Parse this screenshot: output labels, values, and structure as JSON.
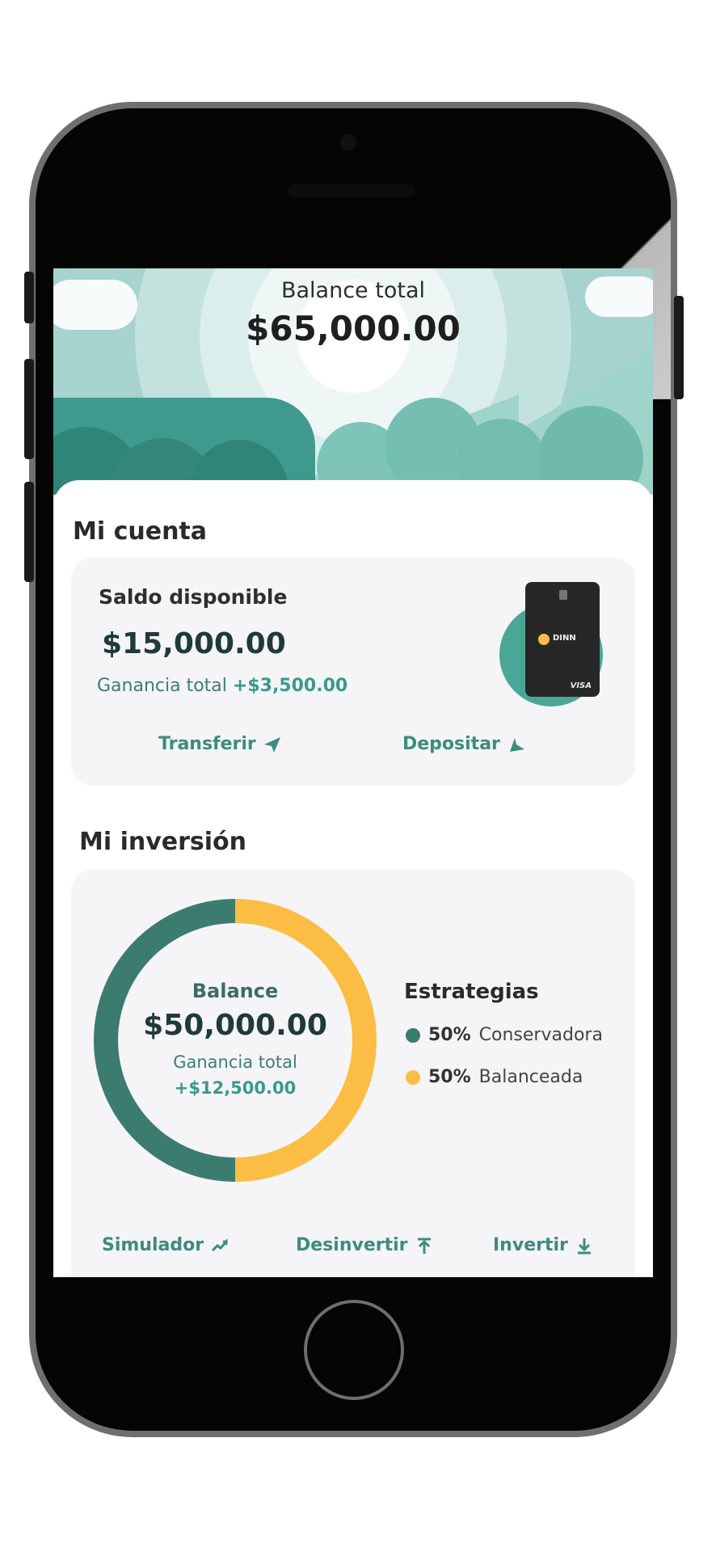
{
  "hero": {
    "title": "Balance total",
    "amount": "$65,000.00"
  },
  "account": {
    "section_title": "Mi cuenta",
    "available_label": "Saldo disponible",
    "available_amount": "$15,000.00",
    "gain_label": "Ganancia total",
    "gain_value": "+$3,500.00",
    "card_brand_text": "DINN",
    "card_network": "VISA",
    "actions": [
      {
        "label": "Transferir",
        "icon": "send-icon"
      },
      {
        "label": "Depositar",
        "icon": "deposit-icon"
      }
    ]
  },
  "investment": {
    "section_title": "Mi inversión",
    "balance_label": "Balance",
    "balance_amount": "$50,000.00",
    "gain_label": "Ganancia total",
    "gain_value": "+$12,500.00",
    "strategies_title": "Estrategias",
    "strategies": [
      {
        "percent": "50%",
        "name": "Conservadora",
        "color": "#3b7c6e"
      },
      {
        "percent": "50%",
        "name": "Balanceada",
        "color": "#fcbd44"
      }
    ],
    "actions": [
      {
        "label": "Simulador",
        "icon": "trend-icon"
      },
      {
        "label": "Desinvertir",
        "icon": "withdraw-icon"
      },
      {
        "label": "Invertir",
        "icon": "download-icon"
      }
    ]
  },
  "colors": {
    "primary": "#3b7c6e",
    "accent": "#3a9a8a",
    "yellow": "#fcbd44"
  }
}
